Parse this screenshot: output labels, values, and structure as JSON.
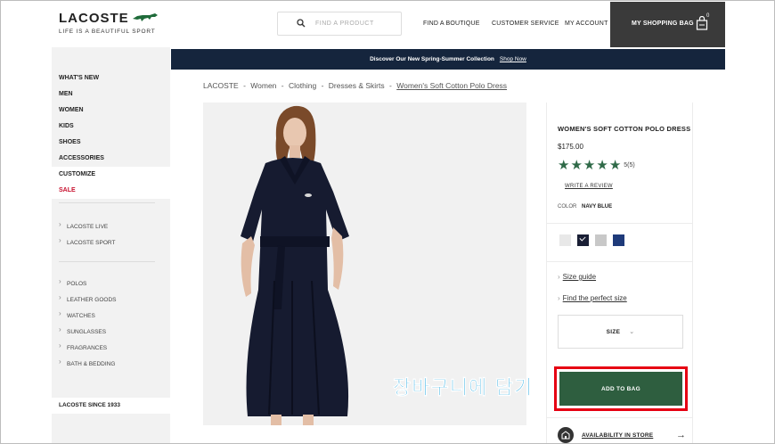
{
  "header": {
    "logo": "LACOSTE",
    "tagline": "LIFE IS A BEAUTIFUL SPORT",
    "search_placeholder": "FIND A PRODUCT",
    "nav": [
      "FIND A BOUTIQUE",
      "CUSTOMER SERVICE",
      "MY ACCOUNT"
    ],
    "bag_label": "MY SHOPPING BAG",
    "bag_count": "0"
  },
  "promo": {
    "text": "Discover Our New Spring-Summer Collection",
    "link": "Shop Now"
  },
  "sidebar": {
    "main": [
      "WHAT'S NEW",
      "MEN",
      "WOMEN",
      "KIDS",
      "SHOES",
      "ACCESSORIES",
      "CUSTOMIZE",
      "SALE"
    ],
    "group1": [
      "LACOSTE LIVE",
      "LACOSTE SPORT"
    ],
    "group2": [
      "POLOS",
      "LEATHER GOODS",
      "WATCHES",
      "SUNGLASSES",
      "FRAGRANCES",
      "BATH & BEDDING"
    ],
    "footer": "LACOSTE SINCE 1933"
  },
  "breadcrumb": {
    "items": [
      "LACOSTE",
      "Women",
      "Clothing",
      "Dresses & Skirts"
    ],
    "current": "Women's Soft Cotton Polo Dress",
    "separator": "-"
  },
  "product": {
    "title": "WOMEN'S SOFT COTTON POLO DRESS",
    "price": "$175.00",
    "rating": 5,
    "review_count": "5(5)",
    "write_review": "WRITE A REVIEW",
    "color_label": "COLOR",
    "color_value": "NAVY BLUE",
    "swatches": [
      {
        "color": "#e8e8e8"
      },
      {
        "color": "#1a1f35",
        "selected": true
      },
      {
        "color": "#c8c8c8"
      },
      {
        "color": "#1f3b7a"
      }
    ],
    "size_guide": "Size guide",
    "perfect_size": "Find the perfect size",
    "size_label": "SIZE",
    "add_to_bag": "ADD TO BAG",
    "availability": "AVAILABILITY IN STORE"
  },
  "annotation": "장바구니에 담기",
  "colors": {
    "accent_green": "#2e5e3f",
    "promo_bg": "#15253d",
    "sale_red": "#c8102e",
    "highlight_red": "#e60012",
    "annotation_blue": "#1ea6e0"
  }
}
